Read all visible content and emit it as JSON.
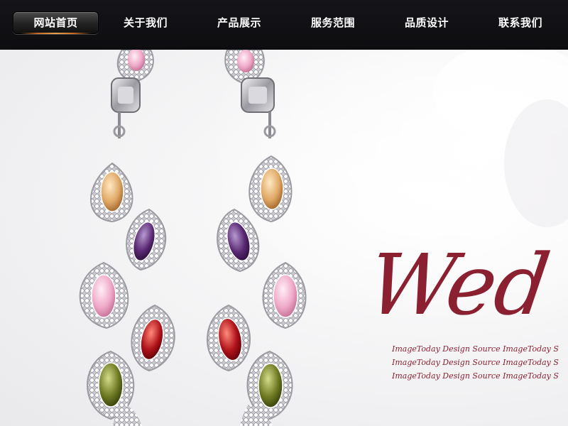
{
  "nav": {
    "items": [
      {
        "label": "网站首页"
      },
      {
        "label": "关于我们"
      },
      {
        "label": "产品展示"
      },
      {
        "label": "服务范围"
      },
      {
        "label": "品质设计"
      },
      {
        "label": "联系我们"
      }
    ],
    "active_index": 0
  },
  "banner": {
    "title": "Wed",
    "source_lines": [
      "ImageToday Design Source ImageToday S",
      "ImageToday Design Source ImageToday S",
      "ImageToday Design Source ImageToday S"
    ],
    "colors": {
      "script": "#8b2130",
      "nav_background": "#111114",
      "active_accent": "#e8a04b"
    },
    "image": "earring-pair-photo"
  }
}
